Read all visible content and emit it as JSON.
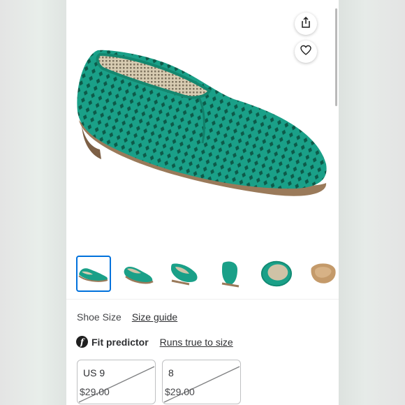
{
  "colors": {
    "accent": "#0071dc",
    "shoe": "#1aa088",
    "sole": "#9a7a5a"
  },
  "toolbar": {
    "share_icon": "share-icon",
    "favorite_icon": "heart-icon"
  },
  "product": {
    "thumbnail_count": 6,
    "selected_thumbnail": 0
  },
  "size": {
    "label": "Shoe Size",
    "guide_link": "Size guide"
  },
  "fit": {
    "icon_letter": "f",
    "title": "Fit predictor",
    "link": "Runs true to size"
  },
  "size_options": [
    {
      "size": "US 9",
      "price": "$29.00",
      "available": false
    },
    {
      "size": "8",
      "price": "$29.00",
      "available": false
    }
  ]
}
